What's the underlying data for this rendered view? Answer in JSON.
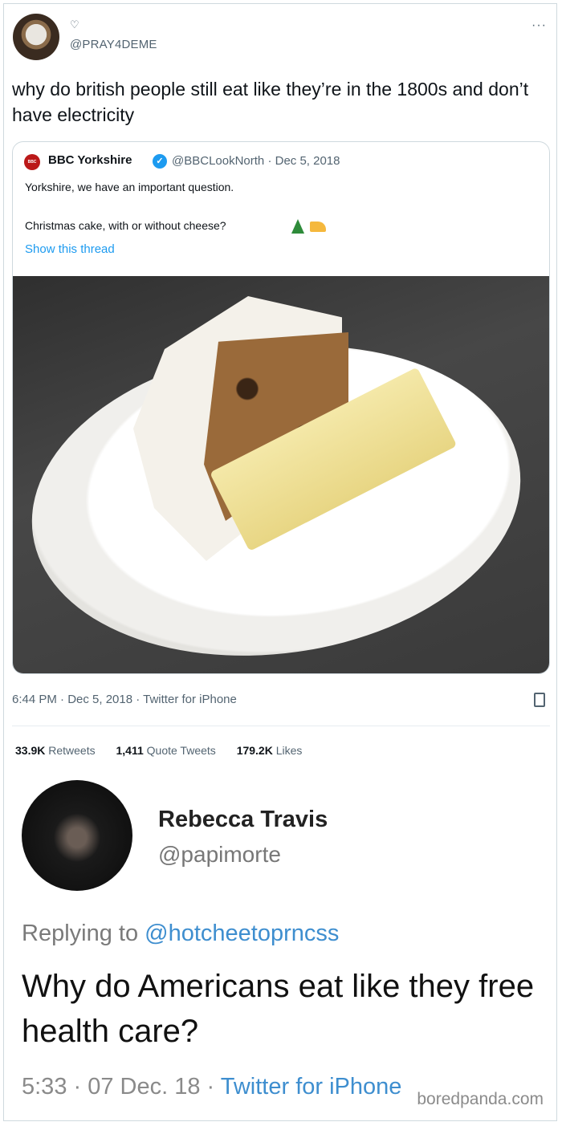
{
  "tweet": {
    "name_symbol": "♡",
    "handle": "@PRAY4DEME",
    "text": "why do british people still eat like they’re in the 1800s and don’t have electricity",
    "more": "···"
  },
  "quoted": {
    "logo_text": "BBC",
    "name": "BBC Yorkshire",
    "handle_date": "@BBCLookNorth · Dec 5, 2018",
    "line1": "Yorkshire, we have an important question.",
    "line2": "Christmas cake, with or without cheese?",
    "show_thread": "Show this thread"
  },
  "meta": {
    "time_line": "6:44 PM · Dec 5, 2018 · Twitter for iPhone"
  },
  "stats": {
    "retweets_count": "33.9K",
    "retweets_label": "Retweets",
    "quotes_count": "1,411",
    "quotes_label": "Quote Tweets",
    "likes_count": "179.2K",
    "likes_label": "Likes"
  },
  "reply": {
    "name": "Rebecca Travis",
    "handle": "@papimorte",
    "replying_prefix": "Replying to",
    "replying_to": "@hotcheetoprncss",
    "text": "Why do Americans eat like they free health care?",
    "time": "5:33 · 07 Dec. 18 ·",
    "via": "Twitter for iPhone"
  },
  "watermark": "boredpanda.com",
  "colors": {
    "link": "#1d9bf0",
    "verified": "#1d9bf0",
    "bbc_red": "#bb1919"
  }
}
